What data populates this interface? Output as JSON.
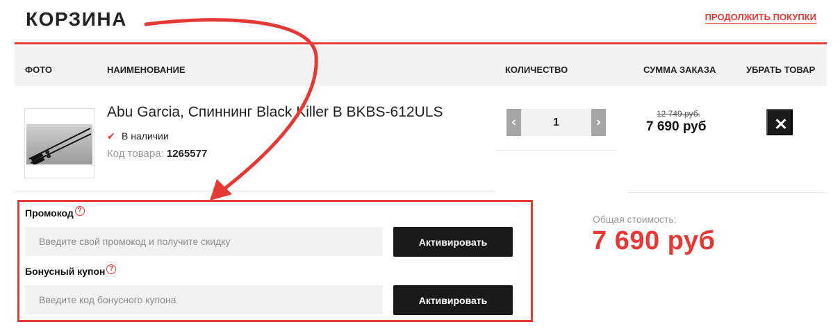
{
  "header": {
    "title": "КОРЗИНА",
    "continue_link": "ПРОДОЛЖИТЬ ПОКУПКИ"
  },
  "table": {
    "columns": [
      "ФОТО",
      "НАИМЕНОВАНИЕ",
      "КОЛИЧЕСТВО",
      "СУММА ЗАКАЗА",
      "УБРАТЬ ТОВАР"
    ]
  },
  "item": {
    "image_icon": "product-photo",
    "name": "Abu Garcia, Спиннинг Black Killer B BKBS-612ULS",
    "stock_icon": "check-icon",
    "stock": "В наличии",
    "sku_label": "Код товара:",
    "sku": "1265577",
    "quantity": "1",
    "old_price": "12 749 руб.",
    "price": "7 690 руб",
    "remove_icon": "close-icon"
  },
  "promo": {
    "label": "Промокод",
    "placeholder": "Введите свой промокод и получите скидку",
    "button": "Активировать"
  },
  "coupon": {
    "label": "Бонусный купон",
    "placeholder": "Введите код бонусного купона",
    "button": "Активировать"
  },
  "summary": {
    "total_label": "Общая стоимость:",
    "total_value": "7 690 руб"
  },
  "colors": {
    "accent": "#e53935",
    "dark": "#1a1a1a",
    "header_bg": "#f2f2f2"
  },
  "help_icon": "?"
}
